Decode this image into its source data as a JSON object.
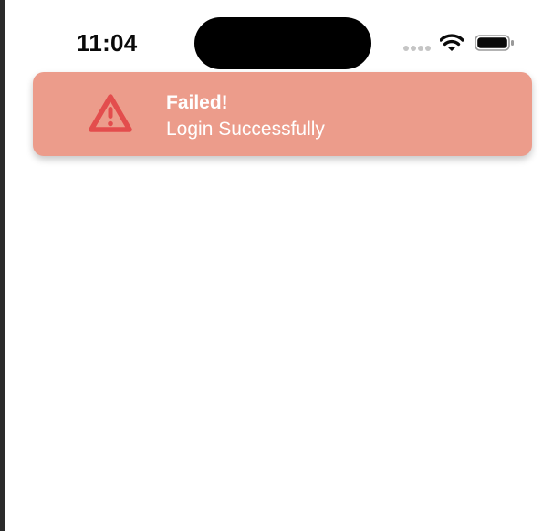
{
  "status_bar": {
    "time": "11:04",
    "icons": [
      "signal-icon",
      "wifi-icon",
      "battery-icon"
    ]
  },
  "toast": {
    "icon": "warning-triangle-icon",
    "title": "Failed!",
    "message": "Login Successfully",
    "colors": {
      "background": "#ec9c8b",
      "icon": "#e34d4d",
      "text": "#ffffff"
    }
  }
}
